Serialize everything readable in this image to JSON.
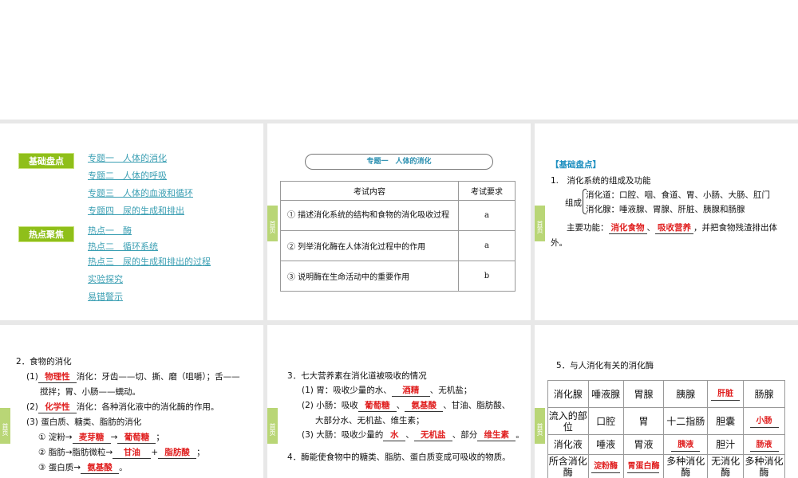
{
  "side_tab": "首页",
  "slide1": {
    "sections": [
      "基础盘点",
      "热点聚焦"
    ],
    "links_basic": [
      "专题一　人体的消化",
      "专题二　人体的呼吸",
      "专题三　人体的血液和循环",
      "专题四　尿的生成和排出"
    ],
    "links_hot": [
      "热点一　酶",
      "热点二　循环系统",
      "热点三　尿的生成和排出的过程",
      "实验探究",
      "易错警示"
    ]
  },
  "slide2": {
    "title": "专题一　人体的消化",
    "headers": [
      "考试内容",
      "考试要求"
    ],
    "rows": [
      {
        "content": "① 描述消化系统的结构和食物的消化吸收过程",
        "level": "a"
      },
      {
        "content": "② 列举消化酶在人体消化过程中的作用",
        "level": "a"
      },
      {
        "content": "③ 说明酶在生命活动中的重要作用",
        "level": "b"
      }
    ]
  },
  "slide3": {
    "heading": "【基础盘点】",
    "item1": "1.　消化系统的组成及功能",
    "compose": "组成",
    "tract": "消化道：口腔、咽、食道、胃、小肠、大肠、肛门",
    "glands": "消化腺：唾液腺、胃腺、肝脏、胰腺和肠腺",
    "func_label": "主要功能：",
    "ans1": "消化食物",
    "sep": "、",
    "ans2": "吸收营养",
    "func_tail": "，并把食物残渣排出体",
    "func_end": "外。"
  },
  "slide4": {
    "title": "2．食物的消化",
    "p1_pre": "(1)",
    "p1_ans": "物理性",
    "p1_text": "消化：牙齿——切、撕、磨（咀嚼）；舌——",
    "p1_cont": "搅拌；胃、小肠——蠕动。",
    "p2_pre": "(2)",
    "p2_ans": "化学性",
    "p2_text": "消化：各种消化液中的消化酶的作用。",
    "p3": "(3) 蛋白质、糖类、脂肪的消化",
    "s1_pre": "① 淀粉→",
    "s1_a": "麦芽糖",
    "arrow": "→",
    "s1_b": "葡萄糖",
    "semi": "；",
    "s2_pre": "② 脂肪→脂肪微粒→",
    "s2_a": "甘油",
    "plus": "+",
    "s2_b": "脂肪酸",
    "s3_pre": "③ 蛋白质→",
    "s3_a": "氨基酸",
    "s3_end": "。"
  },
  "slide5": {
    "title": "3．七大营养素在消化道被吸收的情况",
    "l1_pre": "(1) 胃：吸收少量的水、",
    "l1_a": "酒精",
    "l1_end": "、无机盐；",
    "l2_pre": "(2) 小肠：吸收",
    "l2_a": "葡萄糖",
    "l2_sep": "、",
    "l2_b": "氨基酸",
    "l2_end": "、甘油、脂肪酸、",
    "l2_cont": "大部分水、无机盐、维生素；",
    "l3_pre": "(3) 大肠：吸收少量的",
    "l3_a": "水",
    "l3_sep": "、",
    "l3_b": "无机盐",
    "l3_mid": "、部分",
    "l3_c": "维生素",
    "l3_end": "。",
    "item4": "4．酶能使食物中的糖类、脂肪、蛋白质变成可吸收的物质。"
  },
  "slide6": {
    "title": "5．与人消化有关的消化酶",
    "rows": [
      [
        "消化腺",
        "唾液腺",
        "胃腺",
        "胰腺",
        "肝脏",
        "肠腺"
      ],
      [
        "流入的部位",
        "口腔",
        "胃",
        "十二指肠",
        "胆囊",
        "小肠"
      ],
      [
        "消化液",
        "唾液",
        "胃液",
        "胰液",
        "胆汁",
        "肠液"
      ],
      [
        "所含消化酶",
        "淀粉酶",
        "胃蛋白酶",
        "多种消化酶",
        "无消化酶",
        "多种消化酶"
      ]
    ],
    "answers": [
      [
        0,
        4
      ],
      [
        1,
        5
      ],
      [
        2,
        3
      ],
      [
        2,
        5
      ],
      [
        3,
        1
      ],
      [
        3,
        2
      ]
    ]
  }
}
